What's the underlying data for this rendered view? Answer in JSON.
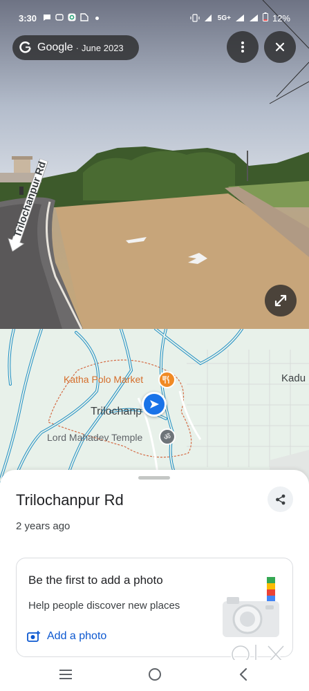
{
  "status_bar": {
    "time": "3:30",
    "network": "5G+",
    "battery": "12%"
  },
  "street_view": {
    "brand": "Google",
    "separator": "·",
    "date": "June 2023",
    "road_label": "Trilochanpur Rd",
    "icons": {
      "more": "more-vert-icon",
      "close": "close-icon",
      "expand": "expand-icon"
    }
  },
  "map": {
    "labels": {
      "market": "Katha Polo Market",
      "village": "Trilochanp",
      "temple": "Lord Mahadev Temple",
      "edge_town": "Kadu"
    },
    "colors": {
      "water": "#1f8fc4",
      "land": "#e8f1ea",
      "market_pin": "#f08a24",
      "location_pin": "#1a73e8"
    }
  },
  "place": {
    "title": "Trilochanpur Rd",
    "subtitle": "2 years ago"
  },
  "photo_card": {
    "title": "Be the first to add a photo",
    "subtitle": "Help people discover new places",
    "action_label": "Add a photo"
  },
  "nav": {
    "icons": [
      "recent-apps-icon",
      "home-icon",
      "back-icon"
    ]
  }
}
